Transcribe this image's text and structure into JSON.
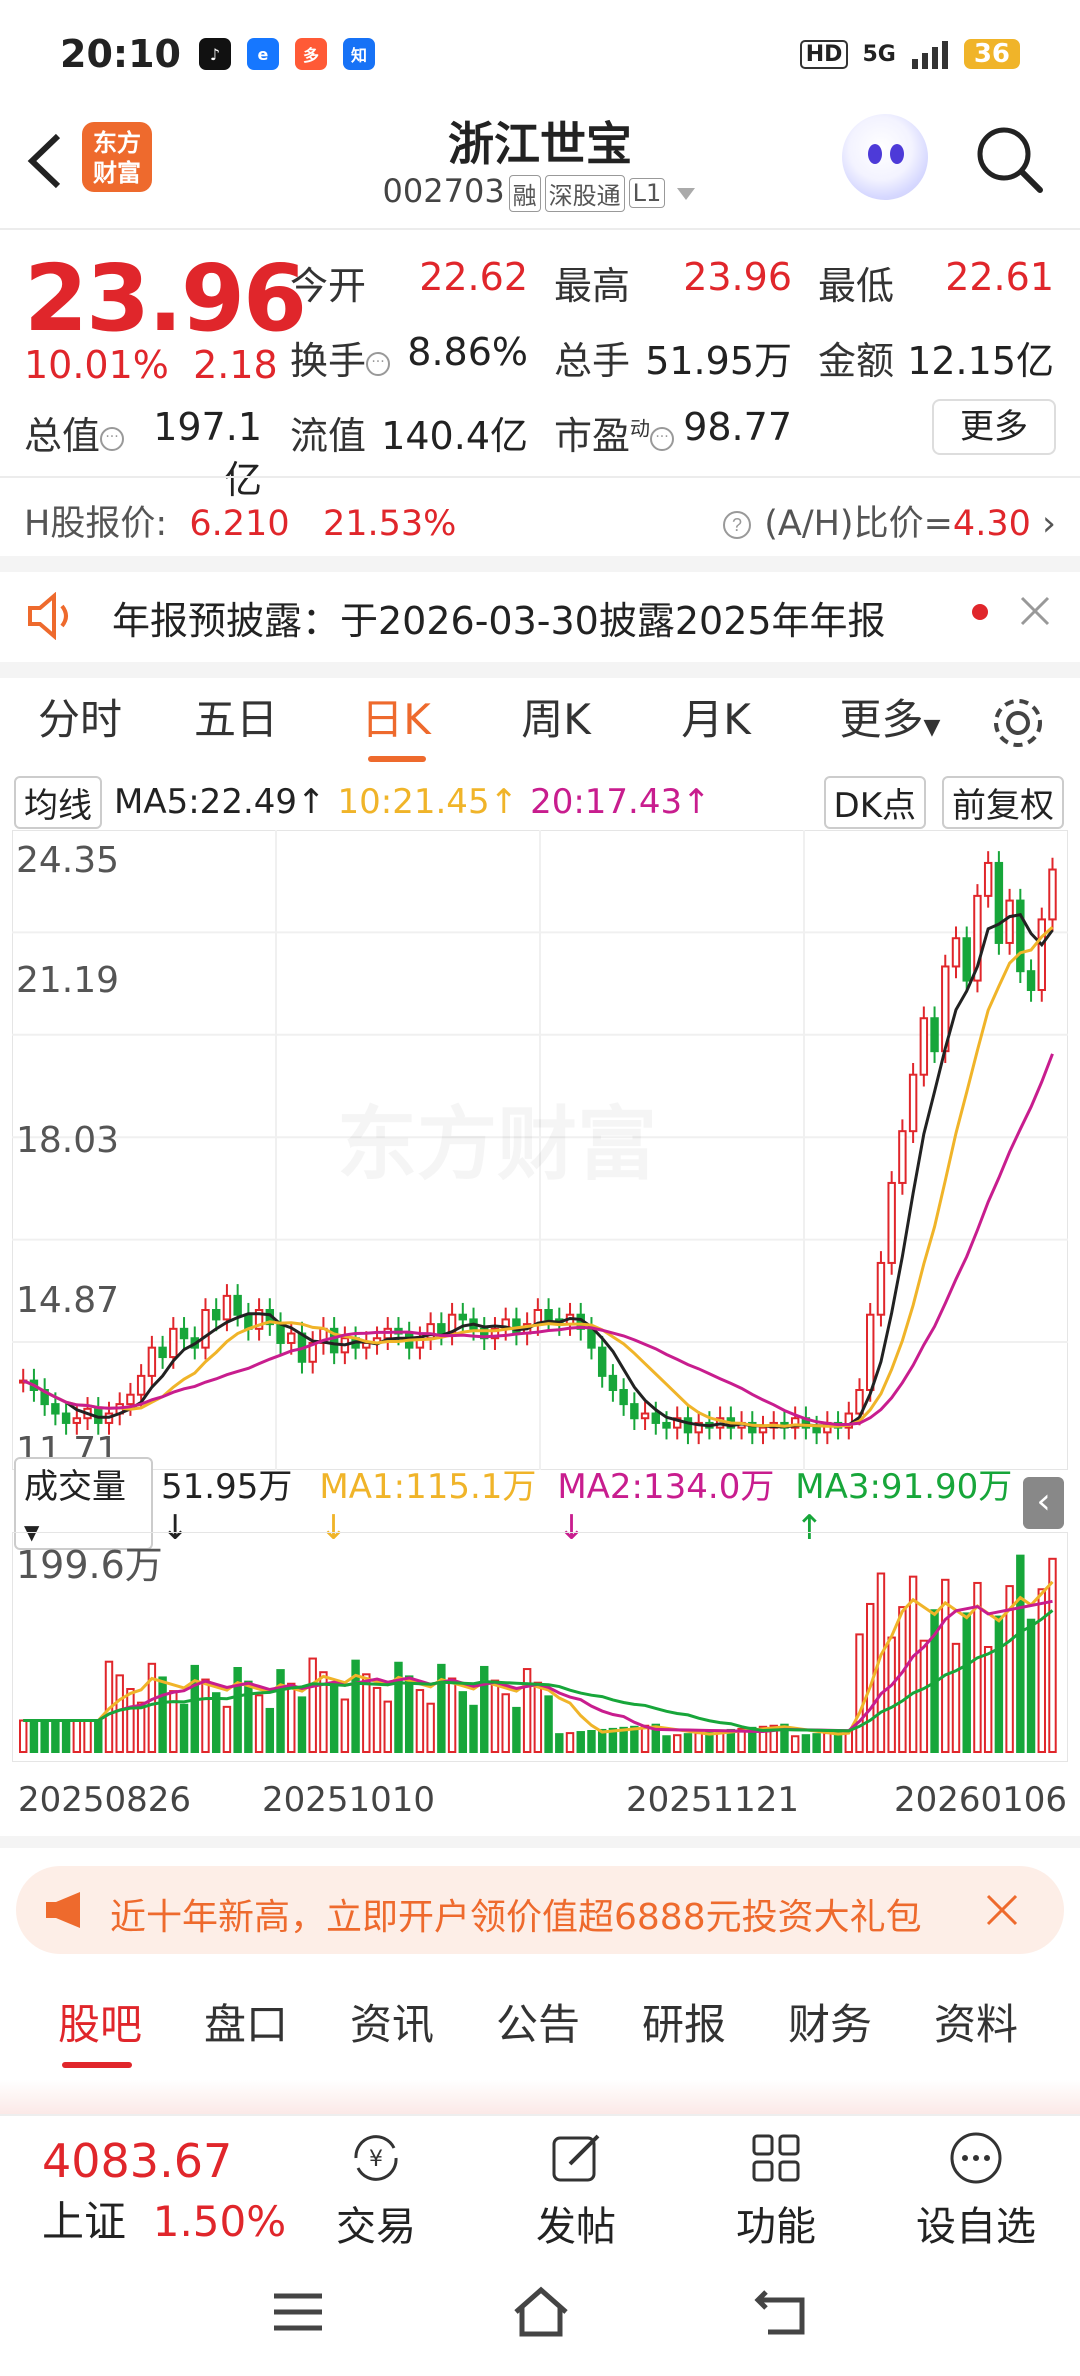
{
  "status_bar": {
    "time": "20:10",
    "network": "5G",
    "hd": "HD",
    "battery": "36"
  },
  "header": {
    "back_icon": "chevron-left-icon",
    "logo_text": "东方\n财富",
    "stock_name": "浙江世宝",
    "stock_code": "002703",
    "tags": [
      "融",
      "深股通",
      "L1"
    ]
  },
  "quote": {
    "price": "23.96",
    "change_pct": "10.01%",
    "change_amt": "2.18",
    "open_label": "今开",
    "open": "22.62",
    "high_label": "最高",
    "high": "23.96",
    "low_label": "最低",
    "low": "22.61",
    "turnover_label": "换手",
    "turnover": "8.86%",
    "volume_label": "总手",
    "volume": "51.95万",
    "amount_label": "金额",
    "amount": "12.15亿",
    "mcap_label": "总值",
    "mcap": "197.1亿",
    "float_label": "流值",
    "float": "140.4亿",
    "pe_label": "市盈",
    "pe_sup": "动",
    "pe": "98.77",
    "more": "更多"
  },
  "hshare": {
    "label": "H股报价:",
    "price": "6.210",
    "pct": "21.53%",
    "ratio_label": "(A/H)比价=",
    "ratio": "4.30"
  },
  "notice": {
    "text": "年报预披露：于2026-03-30披露2025年年报"
  },
  "period_tabs": [
    "分时",
    "五日",
    "日K",
    "周K",
    "月K",
    "更多"
  ],
  "active_tab": "日K",
  "ma": {
    "label": "均线",
    "ma5": "MA5:22.49",
    "ma10": "10:21.45",
    "ma20": "20:17.43",
    "dk": "DK点",
    "adjust": "前复权"
  },
  "price_axis": [
    "24.35",
    "21.19",
    "18.03",
    "14.87",
    "11.71"
  ],
  "watermark": "东方财富",
  "volume": {
    "label": "成交量",
    "value": "51.95万",
    "ma1": "MA1:115.1万",
    "ma2": "MA2:134.0万",
    "ma3": "MA3:91.90万",
    "max": "199.6万"
  },
  "dates": [
    "20250826",
    "20251010",
    "20251121",
    "20260106"
  ],
  "promo": {
    "text": "近十年新高，立即开户领价值超6888元投资大礼包"
  },
  "bottom_tabs": [
    "股吧",
    "盘口",
    "资讯",
    "公告",
    "研报",
    "财务",
    "资料"
  ],
  "bottom_bar": {
    "index_value": "4083.67",
    "index_name": "上证",
    "index_pct": "1.50%",
    "items": [
      "交易",
      "发帖",
      "功能",
      "设自选"
    ]
  },
  "colors": {
    "up": "#e0262b",
    "down": "#17a63a",
    "accent": "#ee6a2d",
    "ma5": "#222222",
    "ma10": "#f0b429",
    "ma20": "#c81d8e"
  },
  "chart_data": {
    "type": "candlestick",
    "description_series": "daily candles 20250826–20260106, price range 11.71–24.35",
    "y_axis": [
      "24.35",
      "21.19",
      "18.03",
      "14.87"
    ]
  }
}
